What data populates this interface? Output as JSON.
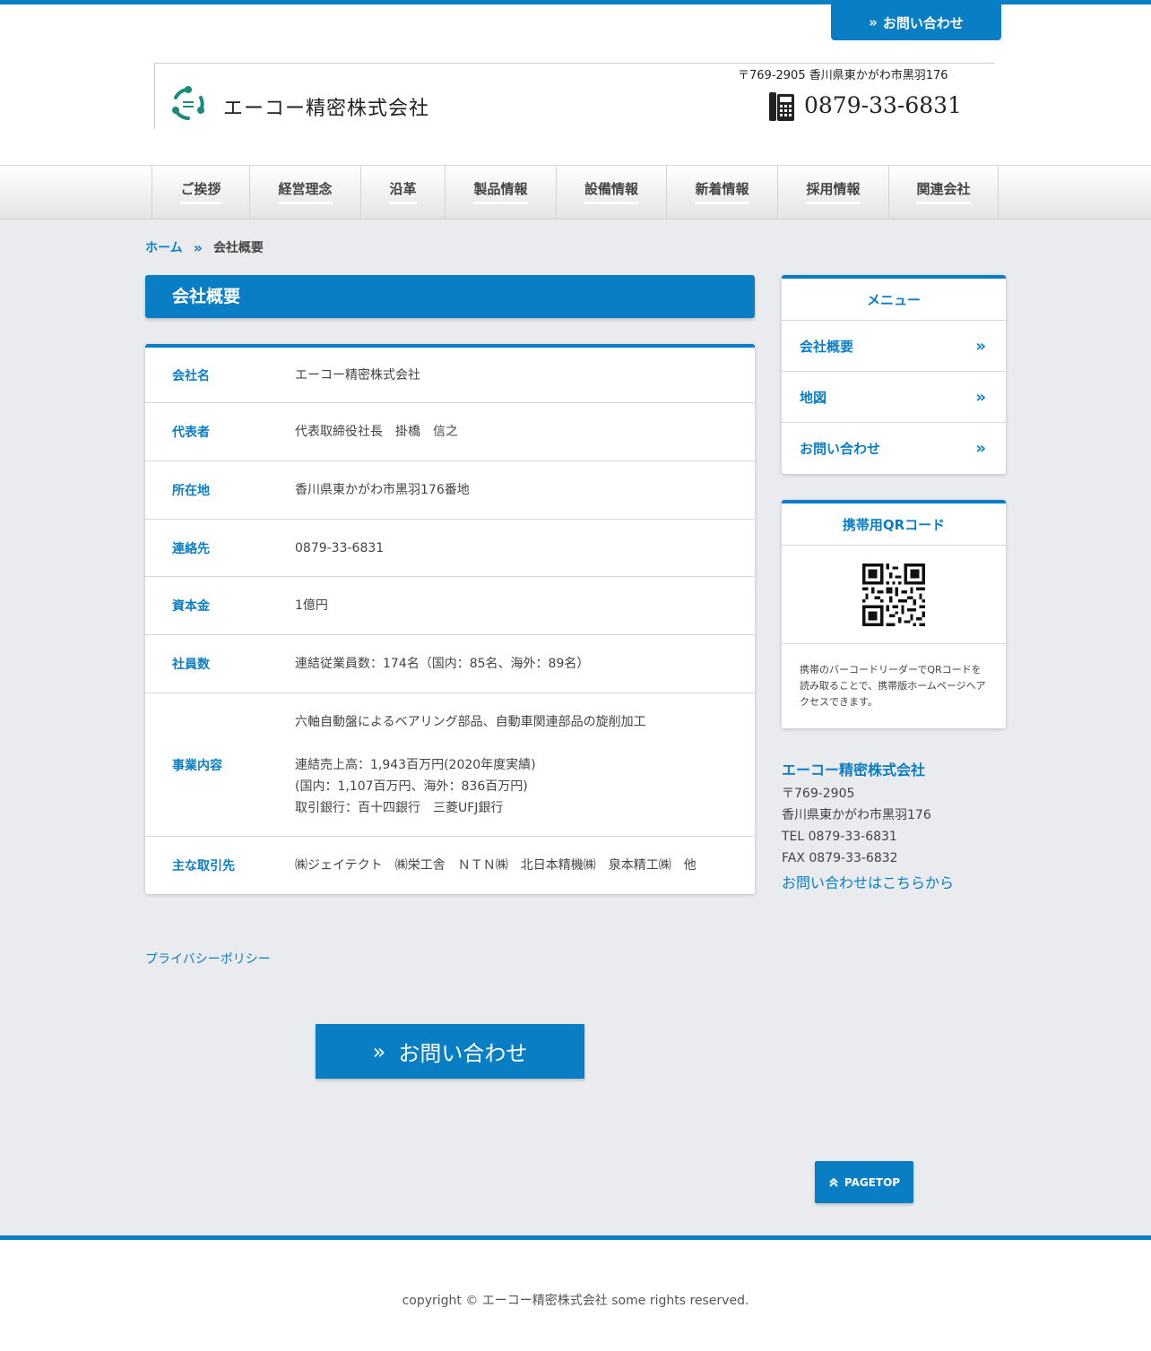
{
  "header": {
    "contact_button": "お問い合わせ",
    "company_name": "エーコー精密株式会社",
    "address": "〒769-2905 香川県東かがわ市黒羽176",
    "phone": "0879-33-6831"
  },
  "nav": {
    "items": [
      {
        "label": "ご挨拶"
      },
      {
        "label": "経営理念"
      },
      {
        "label": "沿革"
      },
      {
        "label": "製品情報"
      },
      {
        "label": "設備情報"
      },
      {
        "label": "新着情報"
      },
      {
        "label": "採用情報"
      },
      {
        "label": "関連会社"
      }
    ]
  },
  "breadcrumb": {
    "home": "ホーム",
    "separator": "»",
    "current": "会社概要"
  },
  "main": {
    "title": "会社概要",
    "rows": [
      {
        "label": "会社名",
        "lines": [
          "エーコー精密株式会社"
        ]
      },
      {
        "label": "代表者",
        "lines": [
          "代表取締役社長　掛橋　信之"
        ]
      },
      {
        "label": "所在地",
        "lines": [
          "香川県東かがわ市黒羽176番地"
        ]
      },
      {
        "label": "連絡先",
        "lines": [
          "0879-33-6831"
        ]
      },
      {
        "label": "資本金",
        "lines": [
          "1億円"
        ]
      },
      {
        "label": "社員数",
        "lines": [
          "連結従業員数：174名（国内：85名、海外：89名）"
        ]
      },
      {
        "label": "事業内容",
        "lines": [
          "六軸自動盤によるベアリング部品、自動車関連部品の旋削加工",
          "",
          "連結売上高：1,943百万円(2020年度実績)",
          "(国内：1,107百万円、海外：836百万円)",
          "取引銀行：百十四銀行　三菱UFJ銀行"
        ]
      },
      {
        "label": "主な取引先",
        "lines": [
          "㈱ジェイテクト　㈱栄工舎　ＮＴＮ㈱　北日本精機㈱　泉本精工㈱　他"
        ]
      }
    ],
    "privacy_link": "プライバシーポリシー",
    "contact_button": "お問い合わせ"
  },
  "sidebar": {
    "menu_title": "メニュー",
    "menu_items": [
      {
        "label": "会社概要"
      },
      {
        "label": "地図"
      },
      {
        "label": "お問い合わせ"
      }
    ],
    "qr_title": "携帯用QRコード",
    "qr_text": "携帯のバーコードリーダーでQRコードを読み取ることで、携帯版ホームページへアクセスできます。",
    "company": {
      "name": "エーコー精密株式会社",
      "zip": "〒769-2905",
      "address": "香川県東かがわ市黒羽176",
      "tel": "TEL 0879-33-6831",
      "fax": "FAX 0879-33-6832",
      "contact_link": "お問い合わせはこちらから"
    }
  },
  "pagetop": "PAGETOP",
  "footer": {
    "copyright": "copyright © エーコー精密株式会社 some rights reserved."
  },
  "colors": {
    "accent": "#0a7ec5",
    "logo": "#1b8a7a"
  }
}
